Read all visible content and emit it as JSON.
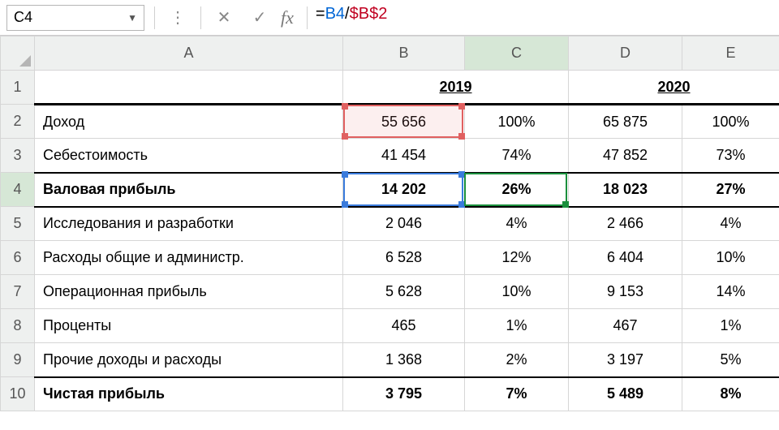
{
  "formula_bar": {
    "name_box": "C4",
    "formula_prefix": "=",
    "formula_ref1": "B4",
    "formula_op": "/",
    "formula_ref2": "$B$2"
  },
  "columns": [
    "A",
    "B",
    "C",
    "D",
    "E"
  ],
  "row_numbers": [
    "1",
    "2",
    "3",
    "4",
    "5",
    "6",
    "7",
    "8",
    "9",
    "10"
  ],
  "header_years": {
    "y1": "2019",
    "y2": "2020"
  },
  "rows": [
    {
      "label": "Доход",
      "b": "55 656",
      "c": "100%",
      "d": "65 875",
      "e": "100%"
    },
    {
      "label": "Себестоимость",
      "b": "41 454",
      "c": "74%",
      "d": "47 852",
      "e": "73%"
    },
    {
      "label": "Валовая прибыль",
      "b": "14 202",
      "c": "26%",
      "d": "18 023",
      "e": "27%"
    },
    {
      "label": "Исследования и разработки",
      "b": "2 046",
      "c": "4%",
      "d": "2 466",
      "e": "4%"
    },
    {
      "label": "Расходы общие и администр.",
      "b": "6 528",
      "c": "12%",
      "d": "6 404",
      "e": "10%"
    },
    {
      "label": "Операционная прибыль",
      "b": "5 628",
      "c": "10%",
      "d": "9 153",
      "e": "14%"
    },
    {
      "label": "Проценты",
      "b": "465",
      "c": "1%",
      "d": "467",
      "e": "1%"
    },
    {
      "label": "Прочие доходы и расходы",
      "b": "1 368",
      "c": "2%",
      "d": "3 197",
      "e": "5%"
    },
    {
      "label": "Чистая прибыль",
      "b": "3 795",
      "c": "7%",
      "d": "5 489",
      "e": "8%"
    }
  ],
  "active_cell": "C4",
  "selected_column": "C",
  "selected_row": "4"
}
